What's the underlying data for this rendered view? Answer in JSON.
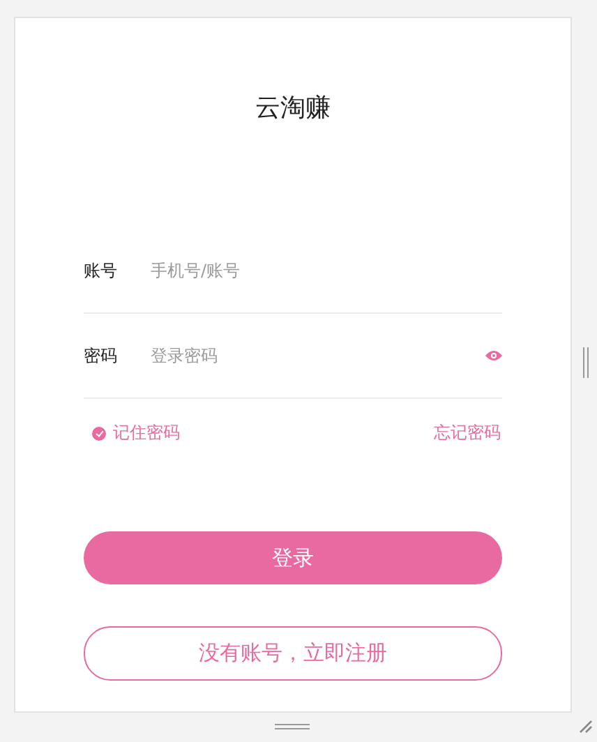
{
  "title": "云淘赚",
  "fields": [
    {
      "label": "账号",
      "placeholder": "手机号/账号",
      "kind": "text"
    },
    {
      "label": "密码",
      "placeholder": "登录密码",
      "kind": "password"
    }
  ],
  "remember": {
    "label": "记住密码",
    "checked": true
  },
  "forgot": "忘记密码",
  "buttons": [
    {
      "label": "登录",
      "kind": "primary"
    },
    {
      "label": "没有账号，立即注册",
      "kind": "outline"
    }
  ]
}
